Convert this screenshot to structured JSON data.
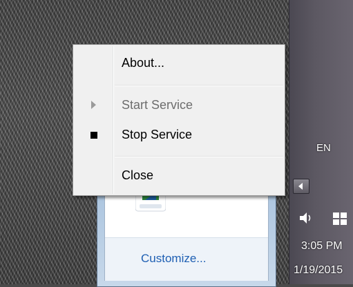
{
  "context_menu": {
    "items": [
      {
        "label": "About...",
        "enabled": true
      },
      {
        "label": "Start Service",
        "enabled": false,
        "icon": "play-arrow-icon"
      },
      {
        "label": "Stop Service",
        "enabled": true,
        "icon": "stop-square-icon"
      },
      {
        "label": "Close",
        "enabled": true
      }
    ]
  },
  "tray_overflow": {
    "customize_label": "Customize..."
  },
  "taskbar": {
    "language": "EN",
    "time": "3:05 PM",
    "date": "1/19/2015"
  },
  "colors": {
    "menu_bg": "#f0f0f0",
    "link": "#1e5fb3",
    "disabled_text": "#6d6d6d"
  }
}
